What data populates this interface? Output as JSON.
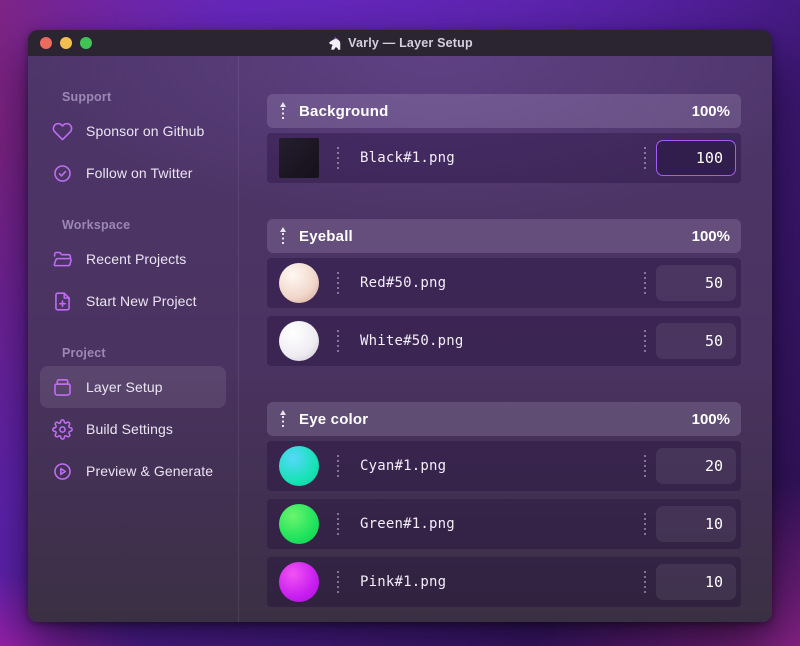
{
  "window": {
    "title": "Varly — Layer Setup"
  },
  "colors": {
    "accent": "#a65bf2",
    "icon": "#c06df4",
    "close": "#ec6a5e",
    "minimize": "#f5bf4f",
    "zoom": "#3fc455"
  },
  "sidebar": {
    "sections": [
      {
        "label": "Support",
        "items": [
          {
            "icon": "heart-icon",
            "label": "Sponsor on Github"
          },
          {
            "icon": "badge-check-icon",
            "label": "Follow on Twitter"
          }
        ]
      },
      {
        "label": "Workspace",
        "items": [
          {
            "icon": "folder-icon",
            "label": "Recent Projects"
          },
          {
            "icon": "file-plus-icon",
            "label": "Start New Project"
          }
        ]
      },
      {
        "label": "Project",
        "items": [
          {
            "icon": "layers-archive-icon",
            "label": "Layer Setup",
            "active": true
          },
          {
            "icon": "gear-icon",
            "label": "Build Settings"
          },
          {
            "icon": "play-circle-icon",
            "label": "Preview & Generate"
          }
        ]
      }
    ]
  },
  "layer_setup": {
    "groups": [
      {
        "name": "Background",
        "weight": "100%",
        "layers": [
          {
            "file": "Black#1.png",
            "value": "100",
            "focused": true,
            "thumb": {
              "shape": "square",
              "colors": [
                "#251e2d",
                "#15101b"
              ]
            }
          }
        ]
      },
      {
        "name": "Eyeball",
        "weight": "100%",
        "layers": [
          {
            "file": "Red#50.png",
            "value": "50",
            "thumb": {
              "shape": "sphere",
              "colors": [
                "#fff8f3",
                "#f1d6ca",
                "#cfa090"
              ]
            }
          },
          {
            "file": "White#50.png",
            "value": "50",
            "thumb": {
              "shape": "sphere",
              "colors": [
                "#ffffff",
                "#efecf2",
                "#c7c0cf"
              ]
            }
          }
        ]
      },
      {
        "name": "Eye color",
        "weight": "100%",
        "layers": [
          {
            "file": "Cyan#1.png",
            "value": "20",
            "thumb": {
              "shape": "sphere",
              "colors": [
                "#55d8fa",
                "#19e2b6",
                "#0ecfa0"
              ]
            }
          },
          {
            "file": "Green#1.png",
            "value": "10",
            "thumb": {
              "shape": "sphere",
              "colors": [
                "#6bf56d",
                "#1fe35c",
                "#12c94e"
              ]
            }
          },
          {
            "file": "Pink#1.png",
            "value": "10",
            "thumb": {
              "shape": "sphere",
              "colors": [
                "#f253f2",
                "#c81ef0",
                "#a212da"
              ]
            }
          }
        ]
      }
    ]
  }
}
